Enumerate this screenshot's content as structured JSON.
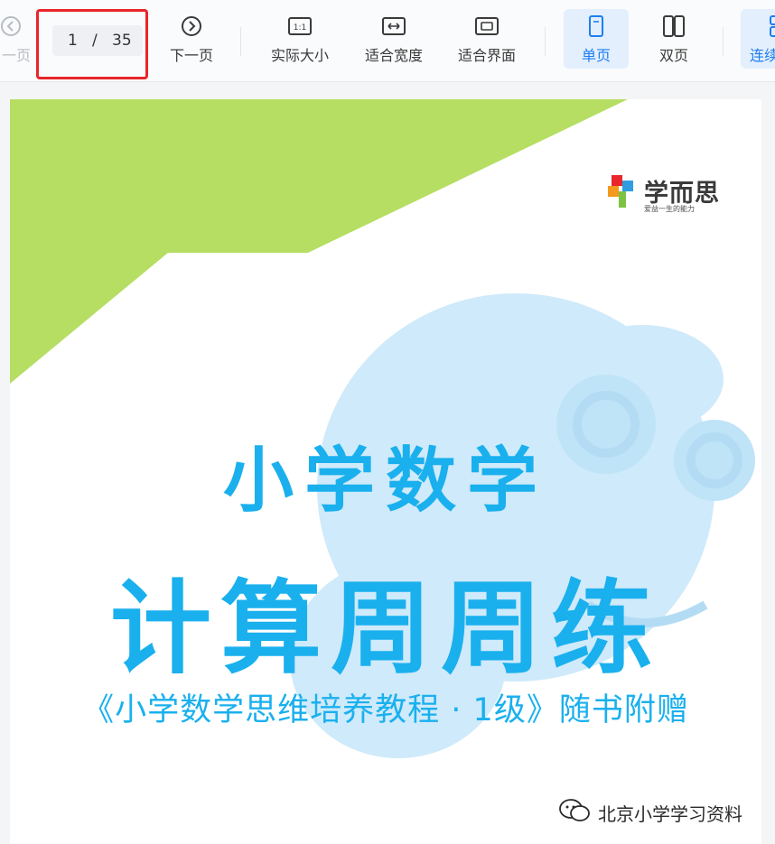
{
  "toolbar": {
    "prev_label": "一页",
    "page_current": "1",
    "page_separator": "/",
    "page_total": "35",
    "next_label": "下一页",
    "actual_size_label": "实际大小",
    "actual_size_icon_text": "1:1",
    "fit_width_label": "适合宽度",
    "fit_page_label": "适合界面",
    "single_page_label": "单页",
    "double_page_label": "双页",
    "continuous_label": "连续",
    "accent_color": "#1e7ef0",
    "highlight_color": "#e8262b"
  },
  "cover": {
    "brand_name": "学而思",
    "brand_tagline": "爱益一生的能力",
    "title_line1": "小学数学",
    "title_line2": "计算周周练",
    "subtitle": "《小学数学思维培养教程 · 1级》随书附赠",
    "title_color": "#1ab0ee",
    "green_band_color": "#b5de63",
    "mascot_color": "#cfeafa"
  },
  "watermark": {
    "text": "北京小学学习资料",
    "icon": "wechat-icon"
  }
}
